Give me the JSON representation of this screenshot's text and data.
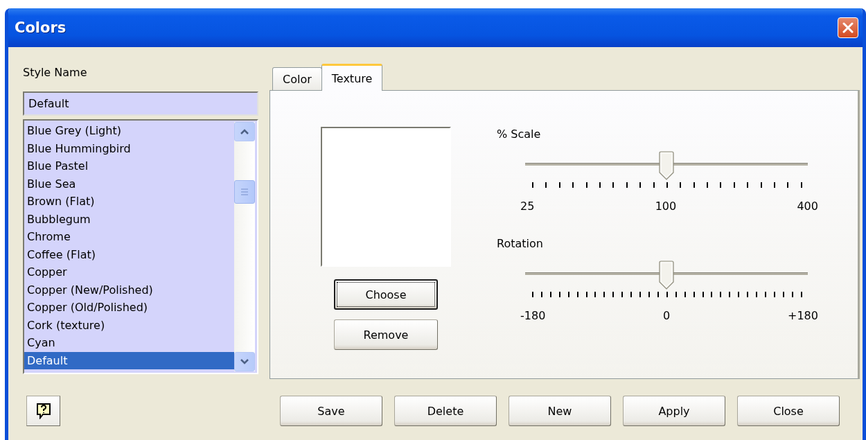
{
  "window": {
    "title": "Colors"
  },
  "style_name": {
    "label": "Style Name",
    "value": "Default"
  },
  "style_list": {
    "items": [
      {
        "label": "Blue Grey (Light)",
        "selected": false
      },
      {
        "label": "Blue Hummingbird",
        "selected": false
      },
      {
        "label": "Blue Pastel",
        "selected": false
      },
      {
        "label": "Blue Sea",
        "selected": false
      },
      {
        "label": "Brown (Flat)",
        "selected": false
      },
      {
        "label": "Bubblegum",
        "selected": false
      },
      {
        "label": "Chrome",
        "selected": false
      },
      {
        "label": "Coffee (Flat)",
        "selected": false
      },
      {
        "label": "Copper",
        "selected": false
      },
      {
        "label": "Copper (New/Polished)",
        "selected": false
      },
      {
        "label": "Copper (Old/Polished)",
        "selected": false
      },
      {
        "label": "Cork (texture)",
        "selected": false
      },
      {
        "label": "Cyan",
        "selected": false
      },
      {
        "label": "Default",
        "selected": true
      }
    ]
  },
  "tabs": [
    {
      "label": "Color",
      "selected": false
    },
    {
      "label": "Texture",
      "selected": true
    }
  ],
  "texture_buttons": [
    {
      "label": "Choose",
      "focused": true
    },
    {
      "label": "Remove",
      "focused": false
    }
  ],
  "sliders": [
    {
      "label": "% Scale",
      "level": 0.5,
      "tick_labels": [
        "25",
        "100",
        "400"
      ]
    },
    {
      "label": "Rotation",
      "level": 0.5,
      "tick_labels": [
        "-180",
        "0",
        "+180"
      ]
    }
  ],
  "buttons": [
    "Save",
    "Delete",
    "New",
    "Apply",
    "Close"
  ]
}
